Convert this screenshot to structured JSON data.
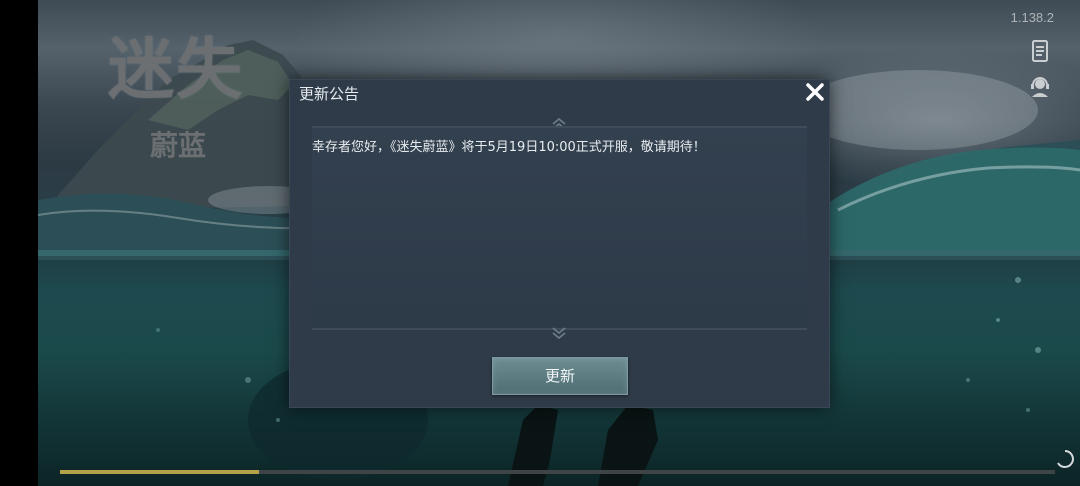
{
  "game": {
    "logo_main": "迷失",
    "logo_sub": "蔚蓝",
    "version": "1.138.2"
  },
  "side_icons": [
    "notice-icon",
    "customer-service-icon"
  ],
  "dialog": {
    "title": "更新公告",
    "close_icon": "close-icon",
    "message": "幸存者您好，《迷失蔚蓝》将于5月19日10:00正式开服，敬请期待！",
    "update_button": "更新"
  },
  "loading": {
    "progress": 0.2,
    "spinner_icon": "loading-spinner-icon"
  },
  "colors": {
    "progress_fill": "#b3a24a",
    "dialog_bg": "#2f3b49",
    "button_bg": "#5e7d83"
  }
}
